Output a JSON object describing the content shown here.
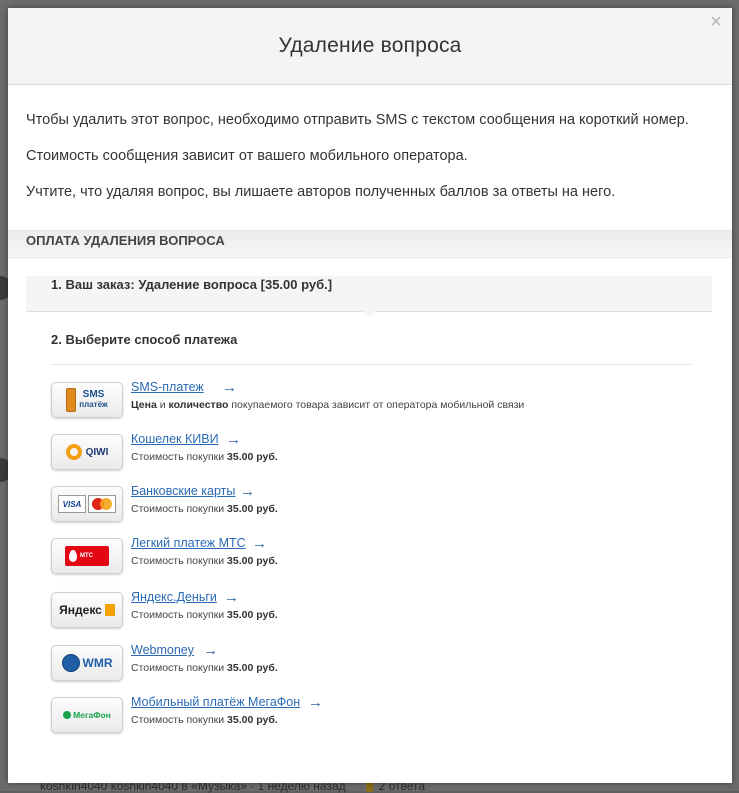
{
  "modal": {
    "title": "Удаление вопроса",
    "close_glyph": "×",
    "intro": [
      "Чтобы удалить этот вопрос, необходимо отправить SMS с текстом сообщения на короткий номер.",
      "Стоимость сообщения зависит от вашего мобильного оператора.",
      "Учтите, что удаляя вопрос, вы лишаете авторов полученных баллов за ответы на него."
    ],
    "payment_title": "Оплата удаления вопроса",
    "step1": "1. Ваш заказ: Удаление вопроса [35.00 руб.]",
    "step2": "2. Выберите способ платежа",
    "arrow_glyph": "→",
    "price_prefix": "Стоимость покупки",
    "price": "35.00 руб.",
    "methods": [
      {
        "name": "SMS-платеж",
        "icon": "sms-payment-icon",
        "logo_text": [
          "SMS",
          "платёж"
        ],
        "desc_bold1": "Цена",
        "desc_mid": " и ",
        "desc_bold2": "количество",
        "desc_rest": " покупаемого товара зависит от оператора мобильной связи"
      },
      {
        "name": "Кошелек КИВИ",
        "icon": "qiwi-icon",
        "logo_text": [
          "QIWI"
        ]
      },
      {
        "name": "Банковские карты",
        "icon": "bank-cards-icon",
        "logo_text": [
          "VISA"
        ]
      },
      {
        "name": "Легкий платеж МТС",
        "icon": "mts-icon",
        "logo_text": [
          "МТС"
        ]
      },
      {
        "name": "Яндекс.Деньги",
        "icon": "yandex-money-icon",
        "logo_text": [
          "Яндекс"
        ]
      },
      {
        "name": "Webmoney",
        "icon": "webmoney-icon",
        "logo_text": [
          "WMR"
        ]
      },
      {
        "name": "Мобильный платёж МегаФон",
        "icon": "megafon-icon",
        "logo_text": [
          "МегаФон"
        ]
      }
    ]
  },
  "background": {
    "footer_text": "koshkin4040 koshkin4040 в «Музыка» · 1 неделю назад",
    "answers": "2 ответа"
  },
  "colors": {
    "link": "#2a6ab5",
    "overlay": "#6b6b6b"
  }
}
